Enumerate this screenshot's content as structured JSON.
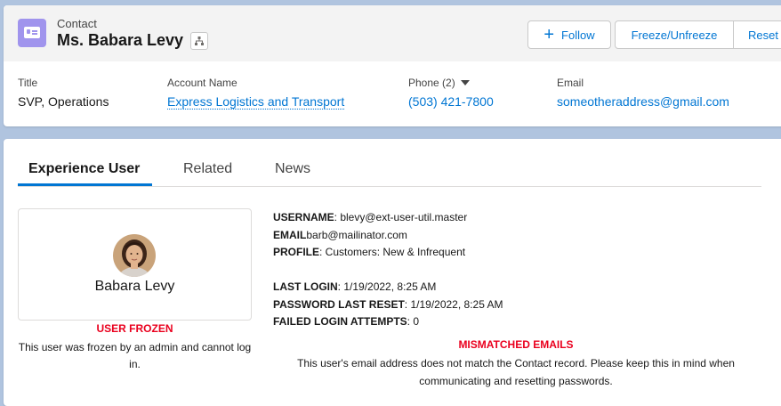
{
  "header": {
    "object_label": "Contact",
    "record_name": "Ms. Babara Levy",
    "icon": "contact-card-icon",
    "buttons": {
      "follow": "Follow",
      "freeze": "Freeze/Unfreeze",
      "reset": "Reset"
    },
    "fields": {
      "title_label": "Title",
      "title_value": "SVP, Operations",
      "account_label": "Account Name",
      "account_value": "Express Logistics and Transport",
      "phone_label": "Phone (2)",
      "phone_value": "(503) 421-7800",
      "email_label": "Email",
      "email_value": "someotheraddress@gmail.com"
    }
  },
  "tabs": [
    {
      "label": "Experience User",
      "active": true
    },
    {
      "label": "Related",
      "active": false
    },
    {
      "label": "News",
      "active": false
    }
  ],
  "profile": {
    "name": "Babara Levy",
    "frozen_title": "USER FROZEN",
    "frozen_message": "This user was frozen by an admin and cannot log in."
  },
  "user_info": {
    "username_label": "USERNAME",
    "username_value": ": blevy@ext-user-util.master",
    "email_label": "EMAIL",
    "email_value": "barb@mailinator.com",
    "profile_label": "PROFILE",
    "profile_value": ": Customers: New & Infrequent",
    "last_login_label": "LAST LOGIN",
    "last_login_value": ": 1/19/2022, 8:25 AM",
    "password_reset_label": "PASSWORD LAST RESET",
    "password_reset_value": ": 1/19/2022, 8:25 AM",
    "failed_attempts_label": "FAILED LOGIN ATTEMPTS",
    "failed_attempts_value": ": 0"
  },
  "mismatch": {
    "title": "MISMATCHED EMAILS",
    "message": "This user's email address does not match the Contact record. Please keep this in mind when communicating and resetting passwords."
  },
  "colors": {
    "brand": "#0176d3",
    "error": "#ea001e",
    "contact_icon": "#a094ed",
    "background": "#b0c4df"
  }
}
